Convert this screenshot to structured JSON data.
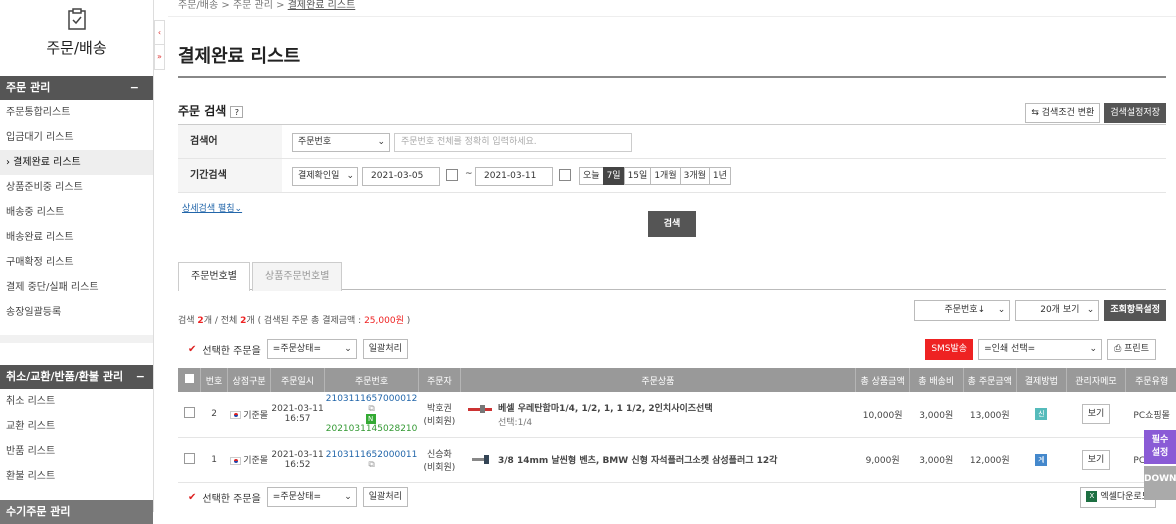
{
  "sidebar": {
    "title": "주문/배송",
    "group1": {
      "label": "주문 관리",
      "toggle": "−"
    },
    "items1": [
      "주문통합리스트",
      "입금대기 리스트",
      "› 결제완료 리스트",
      "상품준비중 리스트",
      "배송중 리스트",
      "배송완료 리스트",
      "구매확정 리스트",
      "결제 중단/실패 리스트",
      "송장일괄등록"
    ],
    "group2": {
      "label": "취소/교환/반품/환불 관리",
      "toggle": "−"
    },
    "items2": [
      "취소 리스트",
      "교환 리스트",
      "반품 리스트",
      "환불 리스트"
    ],
    "group3": {
      "label": "수기주문 관리"
    }
  },
  "breadcrumb": {
    "a": "주문/배송",
    "b": "주문 관리",
    "c": "결제완료 리스트",
    "sep": ">"
  },
  "page": {
    "title": "결제완료 리스트"
  },
  "search": {
    "title": "주문 검색",
    "help": "?",
    "change_btn": "검색조건 변환",
    "save_btn": "검색설정저장",
    "row1_label": "검색어",
    "row1_select": "주문번호",
    "row1_placeholder": "주문번호 전체를 정확히 입력하세요.",
    "row2_label": "기간검색",
    "row2_select": "결제확인일",
    "date_from": "2021-03-05",
    "date_sep": "~",
    "date_to": "2021-03-11",
    "quick": [
      "오늘",
      "7일",
      "15일",
      "1개월",
      "3개월",
      "1년"
    ],
    "detail_link": "상세검색 펼침",
    "submit": "검색"
  },
  "tabs": [
    "주문번호별",
    "상품주문번호별"
  ],
  "summary": {
    "p1": "검색 ",
    "total_found": "2",
    "p2": "개 / 전체 ",
    "total_all": "2",
    "p3": "개 ( 검색된 주문 총 결제금액 : ",
    "amount": "25,000원",
    "p4": " )"
  },
  "controls": {
    "sort": "주문번호↓",
    "per_page": "20개 보기",
    "list_btn": "조회항목설정",
    "sms": "SMS발송",
    "print_select": "=인쇄 선택=",
    "print": "프린트",
    "excel": "엑셀다운로드"
  },
  "bulk": {
    "label": "선택한 주문을",
    "status": "=주문상태=",
    "apply": "일괄처리"
  },
  "table": {
    "headers": [
      "번호",
      "상점구분",
      "주문일시",
      "주문번호",
      "주문자",
      "주문상품",
      "총 상품금액",
      "총 배송비",
      "총 주문금액",
      "결제방법",
      "관리자메모",
      "주문유형"
    ],
    "rows": [
      {
        "no": "2",
        "store": "기준몰",
        "date": "2021-03-11",
        "time": "16:57",
        "order": "2103111657000012",
        "naver": "2021031145028210",
        "buyer": "박호권",
        "buyer_type": "(비회원)",
        "product": "베셀 우레탄함마1/4, 1/2, 1, 1 1/2, 2인치사이즈선택",
        "option": "선택:1/4",
        "goods": "10,000원",
        "ship": "3,000원",
        "total": "13,000원",
        "pay": "신",
        "memo": "보기",
        "type": "PC쇼핑몰"
      },
      {
        "no": "1",
        "store": "기준몰",
        "date": "2021-03-11",
        "time": "16:52",
        "order": "2103111652000011",
        "naver": "",
        "buyer": "신승화",
        "buyer_type": "(비회원)",
        "product": "3/8 14mm 날씬형 벤츠, BMW 신형 자석플러그소켓 삼성플러그 12각",
        "option": "",
        "goods": "9,000원",
        "ship": "3,000원",
        "total": "12,000원",
        "pay": "계",
        "memo": "보기",
        "type": "PC쇼핑몰"
      }
    ]
  },
  "float": {
    "required": "필수\n설정",
    "down": "DOWN"
  }
}
